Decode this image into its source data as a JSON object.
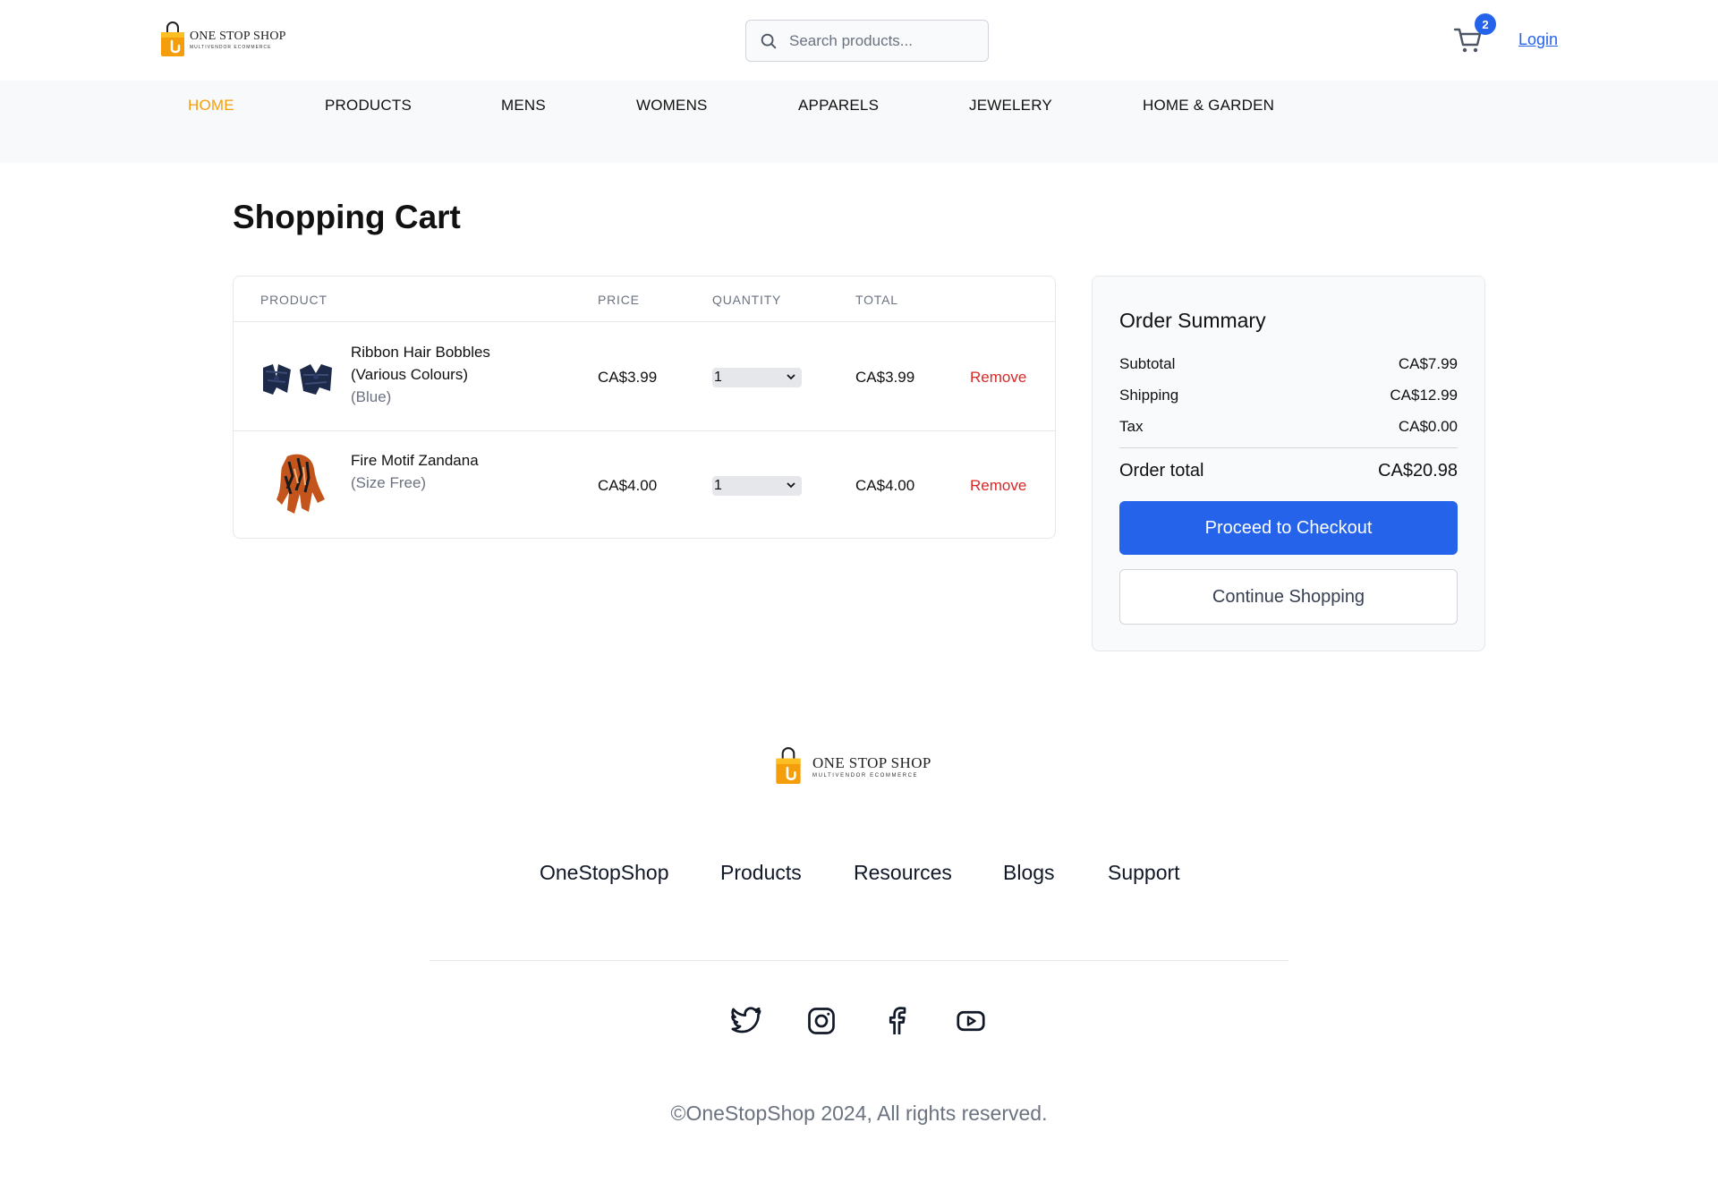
{
  "header": {
    "logo_title": "ONE STOP SHOP",
    "logo_subtitle": "MULTIVENDOR ECOMMERCE",
    "search_placeholder": "Search products...",
    "cart_count": "2",
    "login_label": "Login"
  },
  "nav": {
    "items": [
      {
        "label": "HOME",
        "active": true
      },
      {
        "label": "PRODUCTS"
      },
      {
        "label": "MENS"
      },
      {
        "label": "WOMENS"
      },
      {
        "label": "APPARELS"
      },
      {
        "label": "JEWELERY"
      },
      {
        "label": "HOME & GARDEN"
      }
    ]
  },
  "page_title": "Shopping Cart",
  "cart": {
    "headers": [
      "PRODUCT",
      "PRICE",
      "QUANTITY",
      "TOTAL"
    ],
    "items": [
      {
        "name_line1": "Ribbon Hair Bobbles",
        "name_line2": "(Various Colours)",
        "variant": "(Blue)",
        "price": "CA$3.99",
        "quantity": "1",
        "total": "CA$3.99",
        "remove_label": "Remove"
      },
      {
        "name_line1": "Fire Motif Zandana",
        "variant": "(Size Free)",
        "price": "CA$4.00",
        "quantity": "1",
        "total": "CA$4.00",
        "remove_label": "Remove"
      }
    ]
  },
  "summary": {
    "title": "Order Summary",
    "subtotal_label": "Subtotal",
    "subtotal_value": "CA$7.99",
    "shipping_label": "Shipping",
    "shipping_value": "CA$12.99",
    "tax_label": "Tax",
    "tax_value": "CA$0.00",
    "total_label": "Order total",
    "total_value": "CA$20.98",
    "checkout_label": "Proceed to Checkout",
    "continue_label": "Continue Shopping"
  },
  "footer": {
    "logo_title": "ONE STOP SHOP",
    "logo_subtitle": "MULTIVENDOR ECOMMERCE",
    "links": [
      "OneStopShop",
      "Products",
      "Resources",
      "Blogs",
      "Support"
    ],
    "social_icons": [
      "twitter-icon",
      "instagram-icon",
      "facebook-icon",
      "youtube-icon"
    ],
    "copyright": "©OneStopShop 2024, All rights reserved."
  },
  "colors": {
    "accent": "#2563eb",
    "nav_active": "#f59e0b",
    "remove": "#dc2626",
    "brand_bag": "#f59e0b"
  }
}
